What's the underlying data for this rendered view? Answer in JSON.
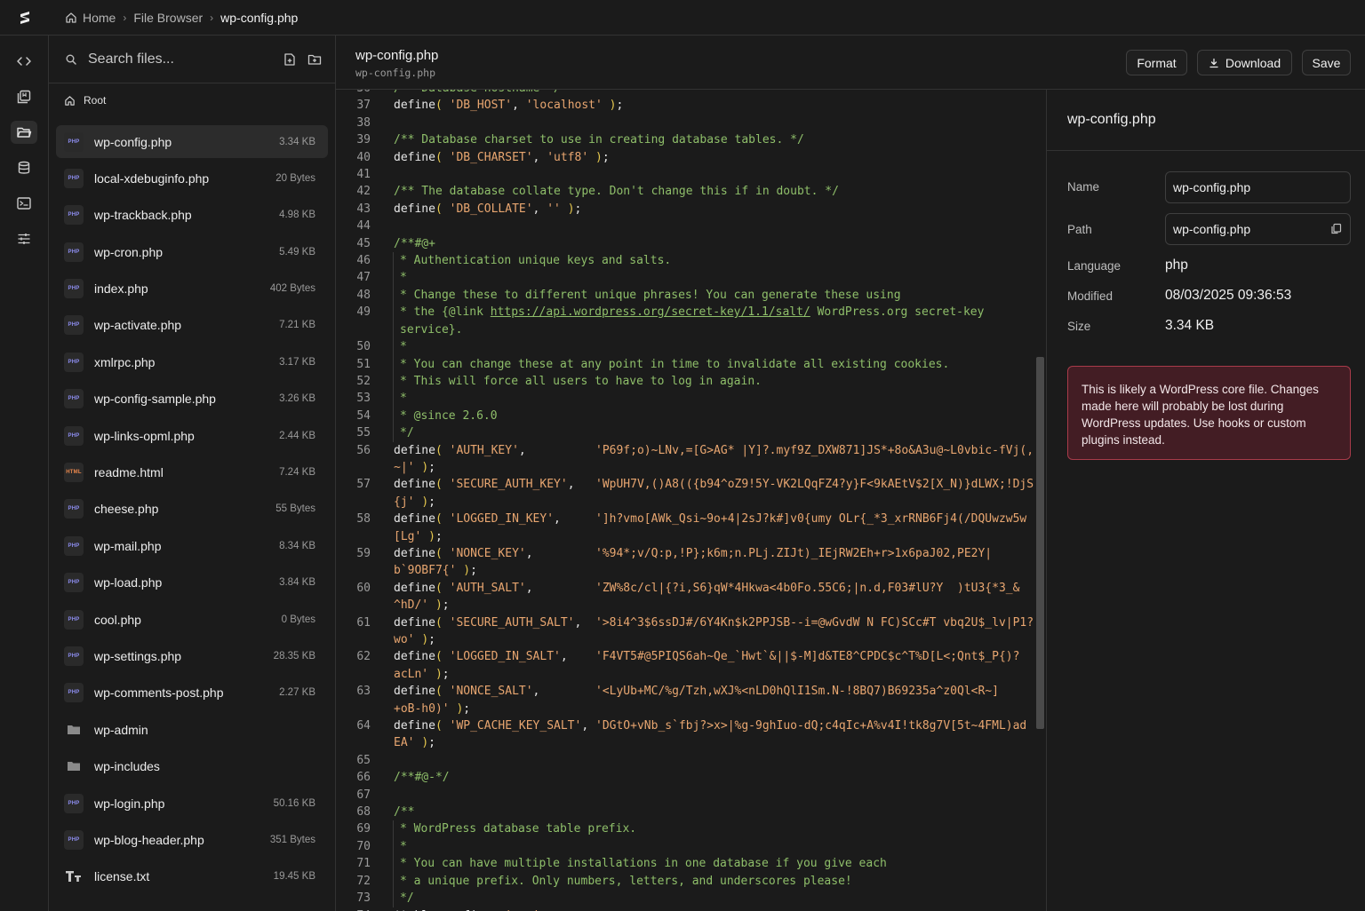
{
  "breadcrumb": {
    "home": "Home",
    "section": "File Browser",
    "current": "wp-config.php"
  },
  "search": {
    "placeholder": "Search files..."
  },
  "root_label": "Root",
  "files": [
    {
      "name": "wp-config.php",
      "size": "3.34 KB",
      "type": "PHP"
    },
    {
      "name": "local-xdebuginfo.php",
      "size": "20 Bytes",
      "type": "PHP"
    },
    {
      "name": "wp-trackback.php",
      "size": "4.98 KB",
      "type": "PHP"
    },
    {
      "name": "wp-cron.php",
      "size": "5.49 KB",
      "type": "PHP"
    },
    {
      "name": "index.php",
      "size": "402 Bytes",
      "type": "PHP"
    },
    {
      "name": "wp-activate.php",
      "size": "7.21 KB",
      "type": "PHP"
    },
    {
      "name": "xmlrpc.php",
      "size": "3.17 KB",
      "type": "PHP"
    },
    {
      "name": "wp-config-sample.php",
      "size": "3.26 KB",
      "type": "PHP"
    },
    {
      "name": "wp-links-opml.php",
      "size": "2.44 KB",
      "type": "PHP"
    },
    {
      "name": "readme.html",
      "size": "7.24 KB",
      "type": "HTML"
    },
    {
      "name": "cheese.php",
      "size": "55 Bytes",
      "type": "PHP"
    },
    {
      "name": "wp-mail.php",
      "size": "8.34 KB",
      "type": "PHP"
    },
    {
      "name": "wp-load.php",
      "size": "3.84 KB",
      "type": "PHP"
    },
    {
      "name": "cool.php",
      "size": "0 Bytes",
      "type": "PHP"
    },
    {
      "name": "wp-settings.php",
      "size": "28.35 KB",
      "type": "PHP"
    },
    {
      "name": "wp-comments-post.php",
      "size": "2.27 KB",
      "type": "PHP"
    },
    {
      "name": "wp-admin",
      "size": "",
      "type": "folder"
    },
    {
      "name": "wp-includes",
      "size": "",
      "type": "folder"
    },
    {
      "name": "wp-login.php",
      "size": "50.16 KB",
      "type": "PHP"
    },
    {
      "name": "wp-blog-header.php",
      "size": "351 Bytes",
      "type": "PHP"
    },
    {
      "name": "license.txt",
      "size": "19.45 KB",
      "type": "text"
    }
  ],
  "editor": {
    "title": "wp-config.php",
    "subtitle": "wp-config.php",
    "format_label": "Format",
    "download_label": "Download",
    "save_label": "Save"
  },
  "code_lines": [
    {
      "n": "36",
      "block": false,
      "parts": [
        [
          "cm",
          "/** Database hostname */"
        ]
      ]
    },
    {
      "n": "37",
      "block": false,
      "parts": [
        [
          "kw",
          "define"
        ],
        [
          "pn",
          "("
        ],
        [
          "kw",
          " "
        ],
        [
          "st",
          "'DB_HOST'"
        ],
        [
          "kw",
          ", "
        ],
        [
          "st",
          "'localhost'"
        ],
        [
          "kw",
          " "
        ],
        [
          "pn",
          ")"
        ],
        [
          "kw",
          ";"
        ]
      ]
    },
    {
      "n": "38",
      "block": false,
      "parts": []
    },
    {
      "n": "39",
      "block": false,
      "parts": [
        [
          "cm",
          "/** Database charset to use in creating database tables. */"
        ]
      ]
    },
    {
      "n": "40",
      "block": false,
      "parts": [
        [
          "kw",
          "define"
        ],
        [
          "pn",
          "("
        ],
        [
          "kw",
          " "
        ],
        [
          "st",
          "'DB_CHARSET'"
        ],
        [
          "kw",
          ", "
        ],
        [
          "st",
          "'utf8'"
        ],
        [
          "kw",
          " "
        ],
        [
          "pn",
          ")"
        ],
        [
          "kw",
          ";"
        ]
      ]
    },
    {
      "n": "41",
      "block": false,
      "parts": []
    },
    {
      "n": "42",
      "block": false,
      "parts": [
        [
          "cm",
          "/** The database collate type. Don't change this if in doubt. */"
        ]
      ]
    },
    {
      "n": "43",
      "block": false,
      "parts": [
        [
          "kw",
          "define"
        ],
        [
          "pn",
          "("
        ],
        [
          "kw",
          " "
        ],
        [
          "st",
          "'DB_COLLATE'"
        ],
        [
          "kw",
          ", "
        ],
        [
          "st",
          "''"
        ],
        [
          "kw",
          " "
        ],
        [
          "pn",
          ")"
        ],
        [
          "kw",
          ";"
        ]
      ]
    },
    {
      "n": "44",
      "block": false,
      "parts": []
    },
    {
      "n": "45",
      "block": false,
      "parts": [
        [
          "cm",
          "/**#@+"
        ]
      ]
    },
    {
      "n": "46",
      "block": true,
      "parts": [
        [
          "cm",
          "* Authentication unique keys and salts."
        ]
      ]
    },
    {
      "n": "47",
      "block": true,
      "parts": [
        [
          "cm",
          "*"
        ]
      ]
    },
    {
      "n": "48",
      "block": true,
      "parts": [
        [
          "cm",
          "* Change these to different unique phrases! You can generate these using"
        ]
      ]
    },
    {
      "n": "49",
      "block": true,
      "parts": [
        [
          "cm",
          "* the {@link "
        ],
        [
          "lk",
          "https://api.wordpress.org/secret-key/1.1/salt/"
        ],
        [
          "cm",
          " WordPress.org secret-key"
        ]
      ]
    },
    {
      "n": "",
      "block": true,
      "parts": [
        [
          "cm",
          "service}."
        ]
      ]
    },
    {
      "n": "50",
      "block": true,
      "parts": [
        [
          "cm",
          "*"
        ]
      ]
    },
    {
      "n": "51",
      "block": true,
      "parts": [
        [
          "cm",
          "* You can change these at any point in time to invalidate all existing cookies."
        ]
      ]
    },
    {
      "n": "52",
      "block": true,
      "parts": [
        [
          "cm",
          "* This will force all users to have to log in again."
        ]
      ]
    },
    {
      "n": "53",
      "block": true,
      "parts": [
        [
          "cm",
          "*"
        ]
      ]
    },
    {
      "n": "54",
      "block": true,
      "parts": [
        [
          "cm",
          "* @since 2.6.0"
        ]
      ]
    },
    {
      "n": "55",
      "block": true,
      "parts": [
        [
          "cm",
          "*/"
        ]
      ]
    },
    {
      "n": "56",
      "block": false,
      "parts": [
        [
          "kw",
          "define"
        ],
        [
          "pn",
          "("
        ],
        [
          "kw",
          " "
        ],
        [
          "st",
          "'AUTH_KEY'"
        ],
        [
          "kw",
          ",          "
        ],
        [
          "st",
          "'P69f;o)~LNv,=[G>AG* |Y]?.myf9Z_DXW871]JS*+8o&A3u@~L0vbic-fVj(,"
        ]
      ]
    },
    {
      "n": "",
      "block": false,
      "parts": [
        [
          "st",
          "~|'"
        ],
        [
          "kw",
          " "
        ],
        [
          "pn",
          ")"
        ],
        [
          "kw",
          ";"
        ]
      ]
    },
    {
      "n": "57",
      "block": false,
      "parts": [
        [
          "kw",
          "define"
        ],
        [
          "pn",
          "("
        ],
        [
          "kw",
          " "
        ],
        [
          "st",
          "'SECURE_AUTH_KEY'"
        ],
        [
          "kw",
          ",   "
        ],
        [
          "st",
          "'WpUH7V,()A8(({b94^oZ9!5Y-VK2LQqFZ4?y}F<9kAEtV$2[X_N)}dLWX;!DjS"
        ]
      ]
    },
    {
      "n": "",
      "block": false,
      "parts": [
        [
          "st",
          "{j'"
        ],
        [
          "kw",
          " "
        ],
        [
          "pn",
          ")"
        ],
        [
          "kw",
          ";"
        ]
      ]
    },
    {
      "n": "58",
      "block": false,
      "parts": [
        [
          "kw",
          "define"
        ],
        [
          "pn",
          "("
        ],
        [
          "kw",
          " "
        ],
        [
          "st",
          "'LOGGED_IN_KEY'"
        ],
        [
          "kw",
          ",     "
        ],
        [
          "st",
          "']h?vmo[AWk_Qsi~9o+4|2sJ?k#]v0{umy OLr{_*3_xrRNB6Fj4(/DQUwzw5w"
        ]
      ]
    },
    {
      "n": "",
      "block": false,
      "parts": [
        [
          "st",
          "[Lg'"
        ],
        [
          "kw",
          " "
        ],
        [
          "pn",
          ")"
        ],
        [
          "kw",
          ";"
        ]
      ]
    },
    {
      "n": "59",
      "block": false,
      "parts": [
        [
          "kw",
          "define"
        ],
        [
          "pn",
          "("
        ],
        [
          "kw",
          " "
        ],
        [
          "st",
          "'NONCE_KEY'"
        ],
        [
          "kw",
          ",         "
        ],
        [
          "st",
          "'%94*;v/Q:p,!P};k6m;n.PLj.ZIJt)_IEjRW2Eh+r>1x6paJ02,PE2Y|"
        ]
      ]
    },
    {
      "n": "",
      "block": false,
      "parts": [
        [
          "st",
          "b`9OBF7{'"
        ],
        [
          "kw",
          " "
        ],
        [
          "pn",
          ")"
        ],
        [
          "kw",
          ";"
        ]
      ]
    },
    {
      "n": "60",
      "block": false,
      "parts": [
        [
          "kw",
          "define"
        ],
        [
          "pn",
          "("
        ],
        [
          "kw",
          " "
        ],
        [
          "st",
          "'AUTH_SALT'"
        ],
        [
          "kw",
          ",         "
        ],
        [
          "st",
          "'ZW%8c/cl|{?i,S6}qW*4Hkwa<4b0Fo.55C6;|n.d,F03#lU?Y  )tU3{*3_&"
        ]
      ]
    },
    {
      "n": "",
      "block": false,
      "parts": [
        [
          "st",
          "^hD/'"
        ],
        [
          "kw",
          " "
        ],
        [
          "pn",
          ")"
        ],
        [
          "kw",
          ";"
        ]
      ]
    },
    {
      "n": "61",
      "block": false,
      "parts": [
        [
          "kw",
          "define"
        ],
        [
          "pn",
          "("
        ],
        [
          "kw",
          " "
        ],
        [
          "st",
          "'SECURE_AUTH_SALT'"
        ],
        [
          "kw",
          ",  "
        ],
        [
          "st",
          "'>8i4^3$6ssDJ#/6Y4Kn$k2PPJSB--i=@wGvdW N FC)SCc#T vbq2U$_lv|P1?"
        ]
      ]
    },
    {
      "n": "",
      "block": false,
      "parts": [
        [
          "st",
          "wo'"
        ],
        [
          "kw",
          " "
        ],
        [
          "pn",
          ")"
        ],
        [
          "kw",
          ";"
        ]
      ]
    },
    {
      "n": "62",
      "block": false,
      "parts": [
        [
          "kw",
          "define"
        ],
        [
          "pn",
          "("
        ],
        [
          "kw",
          " "
        ],
        [
          "st",
          "'LOGGED_IN_SALT'"
        ],
        [
          "kw",
          ",    "
        ],
        [
          "st",
          "'F4VT5#@5PIQS6ah~Qe_`Hwt`&||$-M]d&TE8^CPDC$c^T%D[L<;Qnt$_P{)?"
        ]
      ]
    },
    {
      "n": "",
      "block": false,
      "parts": [
        [
          "st",
          "acLn'"
        ],
        [
          "kw",
          " "
        ],
        [
          "pn",
          ")"
        ],
        [
          "kw",
          ";"
        ]
      ]
    },
    {
      "n": "63",
      "block": false,
      "parts": [
        [
          "kw",
          "define"
        ],
        [
          "pn",
          "("
        ],
        [
          "kw",
          " "
        ],
        [
          "st",
          "'NONCE_SALT'"
        ],
        [
          "kw",
          ",        "
        ],
        [
          "st",
          "'<LyUb+MC/%g/Tzh,wXJ%<nLD0hQlI1Sm.N-!8BQ7)B69235a^z0Ql<R~]"
        ]
      ]
    },
    {
      "n": "",
      "block": false,
      "parts": [
        [
          "st",
          "+oB-h0)'"
        ],
        [
          "kw",
          " "
        ],
        [
          "pn",
          ")"
        ],
        [
          "kw",
          ";"
        ]
      ]
    },
    {
      "n": "64",
      "block": false,
      "parts": [
        [
          "kw",
          "define"
        ],
        [
          "pn",
          "("
        ],
        [
          "kw",
          " "
        ],
        [
          "st",
          "'WP_CACHE_KEY_SALT'"
        ],
        [
          "kw",
          ", "
        ],
        [
          "st",
          "'DGtO+vNb_s`fbj?>x>|%g-9ghIuo-dQ;c4qIc+A%v4I!tk8g7V[5t~4FML)ad"
        ]
      ]
    },
    {
      "n": "",
      "block": false,
      "parts": [
        [
          "st",
          "EA'"
        ],
        [
          "kw",
          " "
        ],
        [
          "pn",
          ")"
        ],
        [
          "kw",
          ";"
        ]
      ]
    },
    {
      "n": "65",
      "block": false,
      "parts": []
    },
    {
      "n": "66",
      "block": false,
      "parts": [
        [
          "cm",
          "/**#@-*/"
        ]
      ]
    },
    {
      "n": "67",
      "block": false,
      "parts": []
    },
    {
      "n": "68",
      "block": false,
      "parts": [
        [
          "cm",
          "/**"
        ]
      ]
    },
    {
      "n": "69",
      "block": true,
      "parts": [
        [
          "cm",
          "* WordPress database table prefix."
        ]
      ]
    },
    {
      "n": "70",
      "block": true,
      "parts": [
        [
          "cm",
          "*"
        ]
      ]
    },
    {
      "n": "71",
      "block": true,
      "parts": [
        [
          "cm",
          "* You can have multiple installations in one database if you give each"
        ]
      ]
    },
    {
      "n": "72",
      "block": true,
      "parts": [
        [
          "cm",
          "* a unique prefix. Only numbers, letters, and underscores please!"
        ]
      ]
    },
    {
      "n": "73",
      "block": true,
      "parts": [
        [
          "cm",
          "*/"
        ]
      ]
    },
    {
      "n": "74",
      "block": false,
      "parts": [
        [
          "kw",
          "$table_prefix = "
        ],
        [
          "st",
          "'wp_'"
        ],
        [
          "kw",
          ";"
        ]
      ]
    }
  ],
  "details": {
    "title": "wp-config.php",
    "name_label": "Name",
    "name_value": "wp-config.php",
    "path_label": "Path",
    "path_value": "wp-config.php",
    "language_label": "Language",
    "language_value": "php",
    "modified_label": "Modified",
    "modified_value": "08/03/2025 09:36:53",
    "size_label": "Size",
    "size_value": "3.34 KB",
    "warning": "This is likely a WordPress core file. Changes made here will probably be lost during WordPress updates. Use hooks or custom plugins instead."
  },
  "colors": {
    "background": "#1b1b1b",
    "border": "#333333",
    "comment": "#8fbf6a",
    "string": "#e8a670",
    "paren": "#e6c84e",
    "php_badge": "#8d8df0",
    "html_badge": "#e9874d",
    "warning_border": "#a83b4a",
    "warning_bg": "#431d24"
  }
}
